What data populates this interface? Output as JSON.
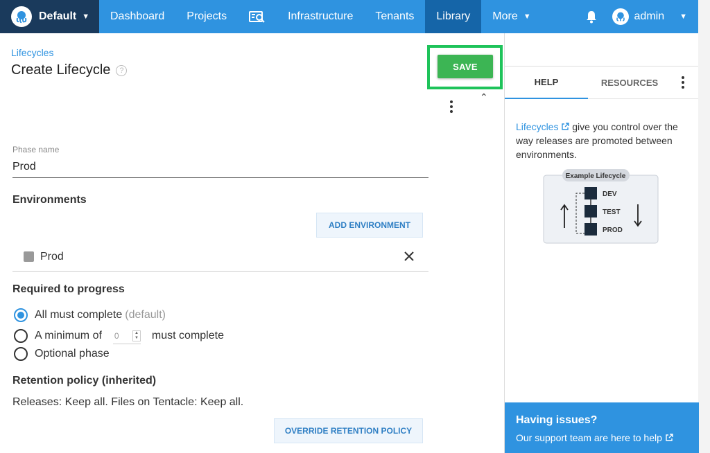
{
  "nav": {
    "space": "Default",
    "items": [
      "Dashboard",
      "Projects",
      "Infrastructure",
      "Tenants",
      "Library",
      "More"
    ],
    "active": "Library",
    "user": "admin"
  },
  "breadcrumb": "Lifecycles",
  "page_title": "Create Lifecycle",
  "save_label": "SAVE",
  "phase": {
    "label": "Phase name",
    "value": "Prod"
  },
  "environments": {
    "heading": "Environments",
    "add_label": "ADD ENVIRONMENT",
    "items": [
      "Prod"
    ]
  },
  "progress": {
    "heading": "Required to progress",
    "option_all": "All must complete",
    "option_all_note": "(default)",
    "option_min_prefix": "A minimum of",
    "option_min_value": "0",
    "option_min_suffix": "must complete",
    "option_optional": "Optional phase"
  },
  "retention": {
    "heading": "Retention policy (inherited)",
    "text": "Releases: Keep all. Files on Tentacle: Keep all.",
    "override_label": "OVERRIDE RETENTION POLICY"
  },
  "side": {
    "tabs": [
      "HELP",
      "RESOURCES"
    ],
    "active_tab": "HELP",
    "help_link": "Lifecycles",
    "help_text": " give you control over the way releases are promoted between environments.",
    "diagram_title": "Example Lifecycle",
    "diagram_stages": [
      "DEV",
      "TEST",
      "PROD"
    ],
    "issues_title": "Having issues?",
    "issues_link": "Our support team are here to help"
  },
  "colors": {
    "nav": "#2f93e0",
    "nav_active": "#1565a8",
    "space": "#1a3a5c",
    "save": "#3cb554",
    "highlight": "#1ec35a"
  }
}
